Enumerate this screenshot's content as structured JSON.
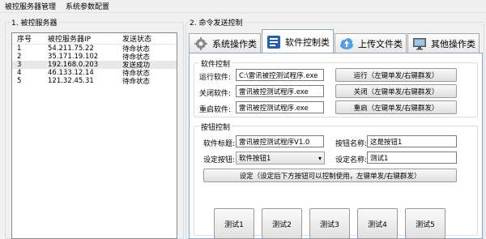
{
  "menu": {
    "items": [
      "被控服务器管理",
      "系统参数配置"
    ]
  },
  "left": {
    "group_title": "1. 被控服务器",
    "columns": [
      "序号",
      "被控服务器IP",
      "发送状态"
    ],
    "rows": [
      {
        "seq": "1",
        "ip": "54.211.75.22",
        "status": "待命状态"
      },
      {
        "seq": "2",
        "ip": "35.171.19.102",
        "status": "待命状态"
      },
      {
        "seq": "3",
        "ip": "192.168.0.203",
        "status": "发送成功"
      },
      {
        "seq": "4",
        "ip": "46.133.12.14",
        "status": "待命状态"
      },
      {
        "seq": "5",
        "ip": "121.32.45.31",
        "status": "待命状态"
      }
    ]
  },
  "right": {
    "group_title": "2. 命令发送控制",
    "tabs": [
      {
        "label": "系统操作类",
        "icon": "gear-icon"
      },
      {
        "label": "软件控制类",
        "icon": "software-icon",
        "active": true
      },
      {
        "label": "上传文件类",
        "icon": "cloud-upload-icon"
      },
      {
        "label": "其他操作类",
        "icon": "monitor-icon"
      }
    ],
    "software": {
      "legend": "软件控制",
      "run_label": "运行软件:",
      "run_value": "C:\\雷讯被控测试程序.exe",
      "run_btn": "运行（左键单发/右键群发）",
      "close_label": "关闭软件:",
      "close_value": "雷讯被控测试程序.exe",
      "close_btn": "关闭（左键单发/右键群发）",
      "restart_label": "重启软件:",
      "restart_value": "雷讯被控测试程序.exe",
      "restart_btn": "重启（左键单发/右键群发）"
    },
    "buttons_ctrl": {
      "legend": "按钮控制",
      "title_label": "软件标题:",
      "title_value": "雷讯被控测试程序V1.0",
      "btn_name_label": "按钮名称:",
      "btn_name_value": "这是按钮1",
      "set_btn_label": "设定按钮:",
      "set_btn_value": "软件按钮1",
      "set_name_label": "设定名称:",
      "set_name_value": "测试1",
      "set_button": "设定（设定后下方按钮可以控制使用，左键单发/右键群发）"
    },
    "tests": [
      "测试1",
      "测试2",
      "测试3",
      "测试4",
      "测试5"
    ]
  }
}
